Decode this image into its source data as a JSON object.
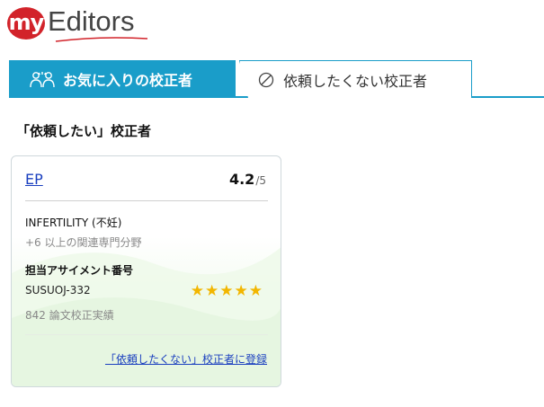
{
  "logo": {
    "badge": "my",
    "text": "Editors"
  },
  "tabs": [
    {
      "label": "お気に入りの校正者",
      "icon": "people-icon",
      "active": true
    },
    {
      "label": "依頼したくない校正者",
      "icon": "block-icon",
      "active": false
    }
  ],
  "section": {
    "heading": "「依頼したい」校正者"
  },
  "card": {
    "name": "EP",
    "rating": "4.2",
    "rating_max": "/5",
    "field": "INFERTILITY (不妊)",
    "field_more": "+6 以上の関連専門分野",
    "assign_label": "担当アサイメント番号",
    "assign_number": "SUSUOJ-332",
    "stars": "★★★★★",
    "star_count": 5,
    "papers": "842 論文校正実績",
    "block_link": "「依頼したくない」校正者に登録"
  },
  "colors": {
    "brand_red": "#d2232a",
    "tab_blue": "#1a9dc9",
    "link_blue": "#1a3fbf",
    "star": "#f2b600"
  }
}
